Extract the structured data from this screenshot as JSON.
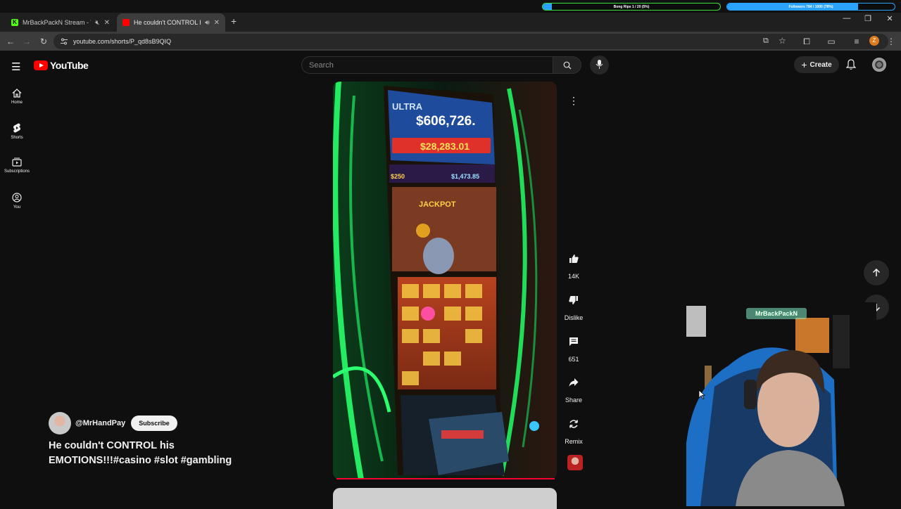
{
  "overlay": {
    "goal_left": {
      "text": "Bong Rips 1 / 20 (5%)",
      "progress": 0.05
    },
    "goal_right": {
      "text": "Followers 784 / 1000 (78%)",
      "progress": 0.78
    }
  },
  "tabs": [
    {
      "title": "MrBackPackN Stream - Wat",
      "favicon": "kick-icon",
      "color": "#53fc18",
      "active": false,
      "audio": "muted"
    },
    {
      "title": "He couldn't CONTROL his E",
      "favicon": "youtube-icon",
      "color": "#ff0000",
      "active": true,
      "audio": "playing"
    }
  ],
  "address_bar": {
    "url": "youtube.com/shorts/P_qd8sB9QIQ"
  },
  "profile_badge": "Z",
  "youtube": {
    "logo_text": "YouTube",
    "search_placeholder": "Search",
    "create_label": "Create",
    "rail": [
      {
        "label": "Home",
        "icon": "home-icon"
      },
      {
        "label": "Shorts",
        "icon": "shorts-icon"
      },
      {
        "label": "Subscriptions",
        "icon": "subscriptions-icon"
      },
      {
        "label": "You",
        "icon": "you-icon"
      }
    ],
    "actions": {
      "like_count": "14K",
      "dislike_label": "Dislike",
      "comment_count": "651",
      "share_label": "Share",
      "remix_label": "Remix"
    },
    "channel_handle": "@MrHandPay",
    "subscribe_label": "Subscribe",
    "video_title": "He couldn't CONTROL his EMOTIONS!!!#casino #slot #gambling",
    "slot_screen": {
      "jackpot_top": "$606,726.",
      "brand": "ULTRA",
      "super_amount": "$28,283.01",
      "small_left": "$250",
      "small_right": "$1,473.85",
      "jackpot_label": "JACKPOT"
    }
  },
  "webcam": {
    "overlay_name": "MrBackPackN"
  },
  "colors": {
    "accent": "#ff0000",
    "overlay_green": "#39e03a",
    "overlay_blue": "#29a3ff"
  }
}
